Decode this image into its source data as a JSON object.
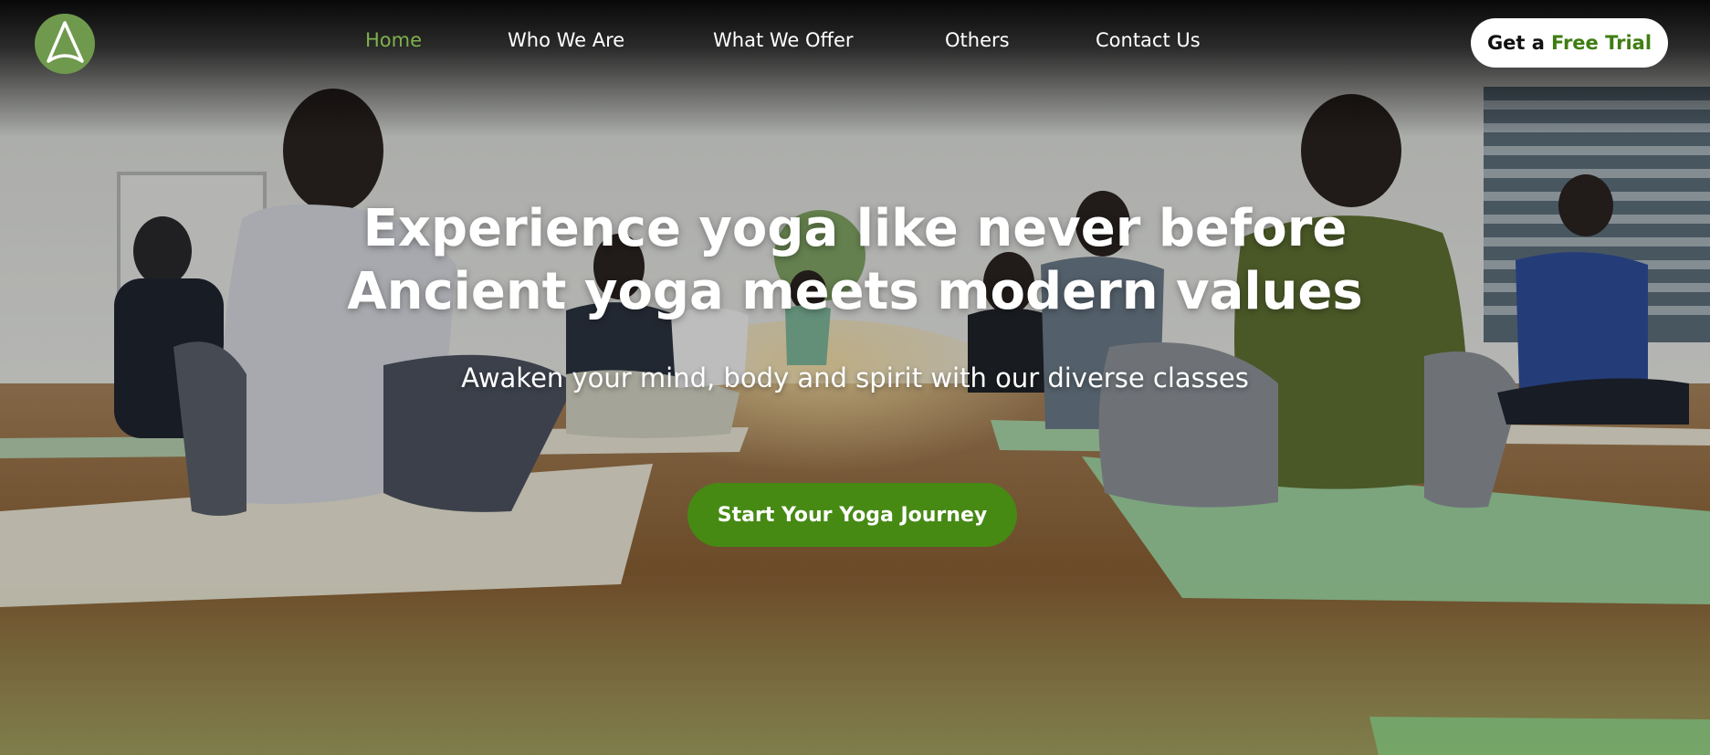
{
  "brand": {
    "logo_icon": "mountain-a-logo-icon",
    "color": "#6f9a4e"
  },
  "nav": {
    "items": [
      {
        "label": "Home",
        "active": true
      },
      {
        "label": "Who We Are",
        "active": false
      },
      {
        "label": "What We Offer",
        "active": false
      },
      {
        "label": "Others",
        "active": false
      },
      {
        "label": "Contact Us",
        "active": false
      }
    ],
    "trial_button": {
      "prefix": "Get a",
      "accent": "Free Trial"
    },
    "active_color": "#7fb04c"
  },
  "hero": {
    "headline_line1": "Experience yoga like never before",
    "headline_line2": "Ancient yoga meets modern values",
    "subheading": "Awaken your mind, body and spirit with our diverse classes",
    "cta_label": "Start Your Yoga Journey",
    "cta_color": "#468a14",
    "background_image": "yoga-class-photo"
  }
}
